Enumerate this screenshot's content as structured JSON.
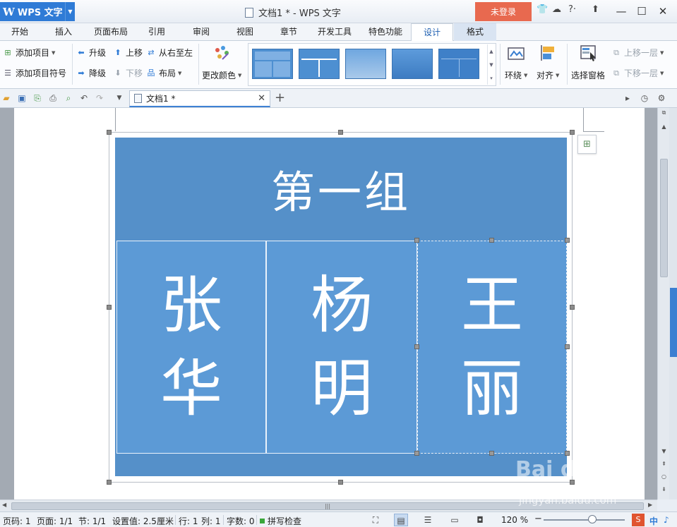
{
  "app": {
    "name": "WPS 文字",
    "window_title": "文档1 * - WPS 文字",
    "login_label": "未登录"
  },
  "menu": {
    "tabs": [
      "开始",
      "插入",
      "页面布局",
      "引用",
      "审阅",
      "视图",
      "章节",
      "开发工具",
      "特色功能",
      "设计",
      "格式"
    ],
    "active": "设计"
  },
  "ribbon": {
    "add_item": "添加项目",
    "add_bullet": "添加项目符号",
    "promote": "升级",
    "demote": "降级",
    "move_up": "上移",
    "move_down": "下移",
    "right_to_left": "从右至左",
    "layout": "布局",
    "change_colors": "更改颜色",
    "wrap": "环绕",
    "align": "对齐",
    "selection_pane": "选择窗格",
    "bring_forward": "上移一层",
    "send_backward": "下移一层"
  },
  "doc_tab": {
    "name": "文档1 *"
  },
  "diagram": {
    "title": "第一组",
    "members": [
      {
        "line1": "张",
        "line2": "华"
      },
      {
        "line1": "杨",
        "line2": "明"
      },
      {
        "line1": "王",
        "line2": "丽"
      }
    ],
    "fill_color": "#5590c9",
    "box_color": "#5c9ad6"
  },
  "status": {
    "page_code": "页码: 1",
    "page": "页面: 1/1",
    "section": "节: 1/1",
    "setting": "设置值: 2.5厘米",
    "row": "行: 1",
    "col": "列: 1",
    "word_count": "字数: 0",
    "spell_check": "拼写检查",
    "zoom": "120 %",
    "ime": "中"
  },
  "watermark": {
    "brand": "Bai du 经验",
    "url": "jingyan.baidu.com"
  }
}
